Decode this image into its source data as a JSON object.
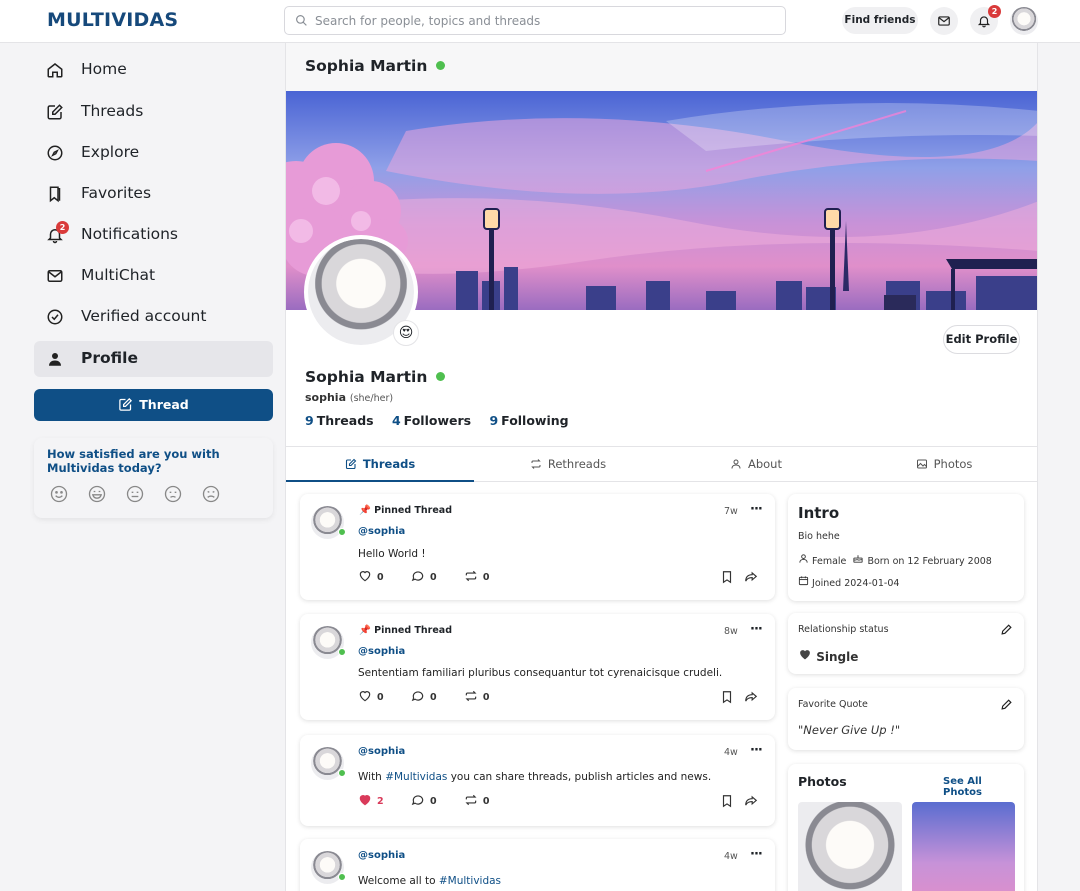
{
  "topbar": {
    "logo": "MULTIVIDAS",
    "search_placeholder": "Search for people, topics and threads",
    "find_friends": "Find friends",
    "notifications_count": "2"
  },
  "sidebar": {
    "items": [
      {
        "label": "Home",
        "icon": "home-icon"
      },
      {
        "label": "Threads",
        "icon": "edit-icon"
      },
      {
        "label": "Explore",
        "icon": "compass-icon"
      },
      {
        "label": "Favorites",
        "icon": "bookmarks-icon"
      },
      {
        "label": "Notifications",
        "icon": "bell-icon",
        "badge": "2"
      },
      {
        "label": "MultiChat",
        "icon": "mail-icon"
      },
      {
        "label": "Verified account",
        "icon": "verified-icon"
      },
      {
        "label": "Profile",
        "icon": "user-icon",
        "active": true
      }
    ],
    "thread_button": "Thread",
    "satisfaction_question": "How satisfied are you with Multividas today?"
  },
  "profile": {
    "header_name": "Sophia Martin",
    "name": "Sophia Martin",
    "username": "sophia",
    "pronouns": "(she/her)",
    "edit_button": "Edit Profile",
    "status_emoji": "😍",
    "stats": {
      "threads_count": "9",
      "threads_label": "Threads",
      "followers_count": "4",
      "followers_label": "Followers",
      "following_count": "9",
      "following_label": "Following"
    }
  },
  "tabs": [
    "Threads",
    "Rethreads",
    "About",
    "Photos"
  ],
  "posts": [
    {
      "pinned": "Pinned Thread",
      "handle": "@sophia",
      "time": "7w",
      "text": "Hello World !",
      "likes": "0",
      "comments": "0",
      "rethreads": "0"
    },
    {
      "pinned": "Pinned Thread",
      "handle": "@sophia",
      "time": "8w",
      "text": "Sententiam familiari pluribus consequantur tot cyrenaicisque crudeli.",
      "likes": "0",
      "comments": "0",
      "rethreads": "0"
    },
    {
      "handle": "@sophia",
      "time": "4w",
      "text_before": "With ",
      "hashtag": "#Multividas",
      "text_after": " you can share threads, publish articles and news.",
      "likes": "2",
      "comments": "0",
      "rethreads": "0",
      "liked": true
    },
    {
      "handle": "@sophia",
      "time": "4w",
      "text_before": "Welcome all to ",
      "hashtag": "#Multividas"
    }
  ],
  "intro": {
    "title": "Intro",
    "bio": "Bio hehe",
    "gender": "Female",
    "born": "Born on 12 February 2008",
    "joined": "Joined 2024-01-04"
  },
  "relationship": {
    "label": "Relationship status",
    "value": "Single"
  },
  "quote": {
    "label": "Favorite Quote",
    "value": "\"Never Give Up !\""
  },
  "photos": {
    "title": "Photos",
    "see_all": "See All Photos"
  },
  "colors": {
    "brand": "#0f4f86",
    "online": "#4fbf4f",
    "badge": "#d93a3a",
    "like": "#d93a5a"
  }
}
